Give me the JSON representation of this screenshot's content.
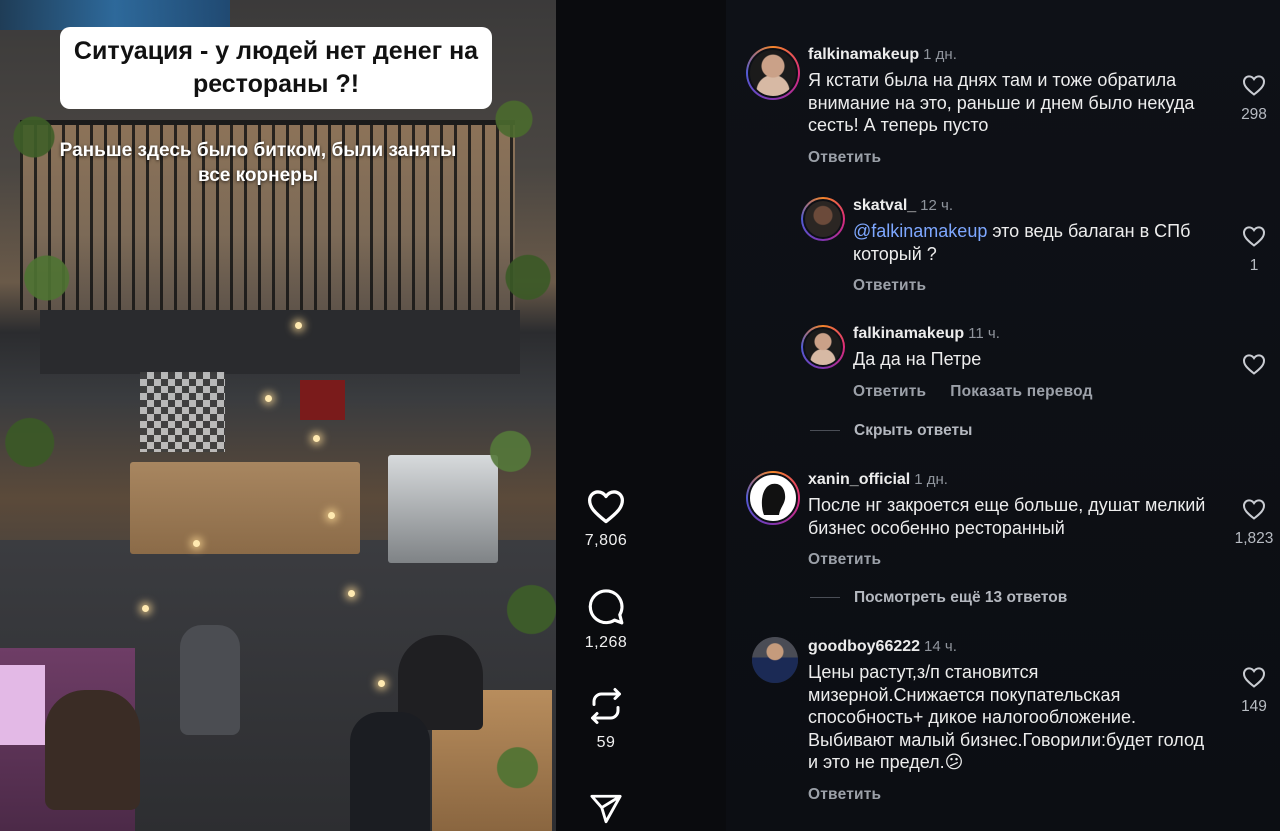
{
  "video": {
    "caption_title": "Ситуация - у людей нет денег на рестораны ?!",
    "caption_subtitle": "Раньше здесь было битком, были заняты все корнеры"
  },
  "actions": {
    "likes": "7,806",
    "comments": "1,268",
    "reposts": "59"
  },
  "comments": [
    {
      "username": "falkinamakeup",
      "time": "1 дн.",
      "text": "Я кстати была на днях там и тоже обратила внимание на это, раньше и днем было некуда сесть! А теперь пусто",
      "reply_label": "Ответить",
      "likes": "298"
    },
    {
      "username": "skatval_",
      "time": "12 ч.",
      "mention": "@falkinamakeup",
      "text": " это ведь балаган в СПб который ?",
      "reply_label": "Ответить",
      "likes": "1"
    },
    {
      "username": "falkinamakeup",
      "time": "11 ч.",
      "text": "Да да на Петре",
      "reply_label": "Ответить",
      "translate_label": "Показать перевод"
    },
    {
      "username": "xanin_official",
      "time": "1 дн.",
      "text": "После нг закроется еще больше, душат мелкий бизнес особенно ресторанный",
      "reply_label": "Ответить",
      "likes": "1,823"
    },
    {
      "username": "goodboy66222",
      "time": "14 ч.",
      "text": "Цены растут,з/п становится мизерной.Снижается покупательская способность+ дикое налогообложение. Выбивают малый бизнес.Говорили:будет голод и это не предел.😕",
      "reply_label": "Ответить",
      "likes": "149"
    }
  ],
  "thread_links": {
    "hide_replies": "Скрыть ответы",
    "more_replies": "Посмотреть ещё 13 ответов"
  },
  "icons": {
    "like": "heart-icon",
    "comment": "comment-bubble-icon",
    "repost": "repost-arrows-icon",
    "share": "send-paper-plane-icon"
  }
}
